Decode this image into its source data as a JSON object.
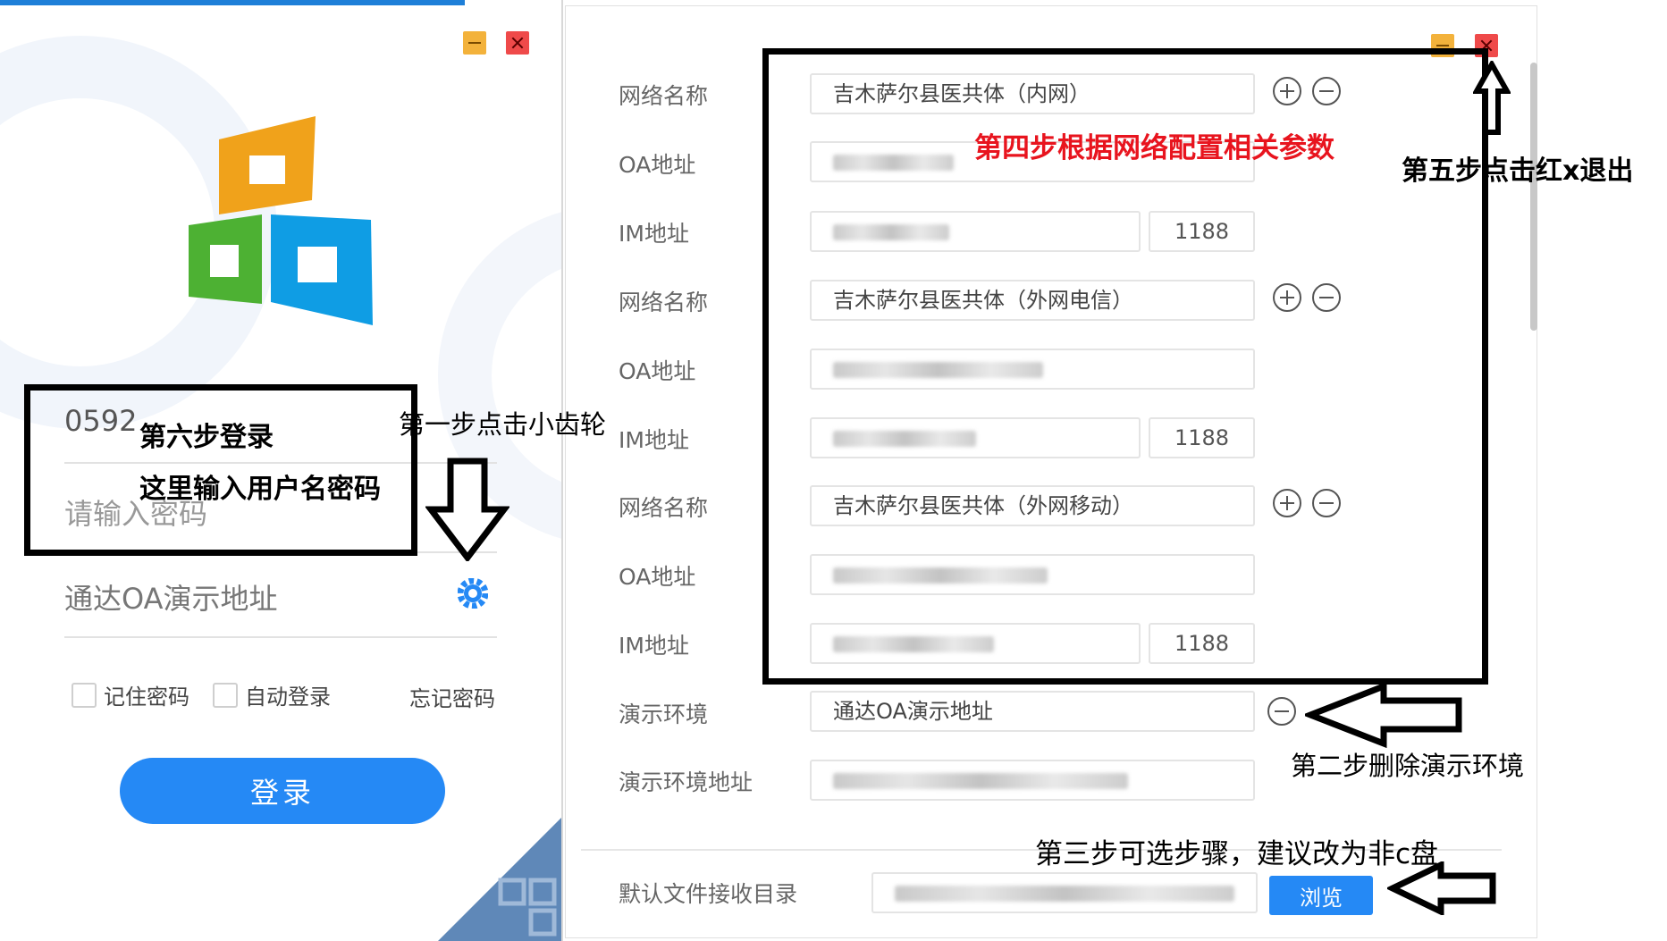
{
  "login": {
    "username_value": "0592",
    "password_placeholder": "请输入密码",
    "server_value": "通达OA演示地址",
    "remember_password": "记住密码",
    "auto_login": "自动登录",
    "forgot_password": "忘记密码",
    "login_button": "登录"
  },
  "settings": {
    "network_label": "网络名称",
    "oa_label": "OA地址",
    "im_label": "IM地址",
    "networks": [
      {
        "name": "吉木萨尔县医共体（内网）",
        "port": "1188"
      },
      {
        "name": "吉木萨尔县医共体（外网电信）",
        "port": "1188"
      },
      {
        "name": "吉木萨尔县医共体（外网移动）",
        "port": "1188"
      }
    ],
    "demo_env_label": "演示环境",
    "demo_env_value": "通达OA演示地址",
    "demo_env_addr_label": "演示环境地址",
    "download_dir_label": "默认文件接收目录",
    "browse_button": "浏览"
  },
  "annotations": {
    "step1": "第一步点击小齿轮",
    "step2": "第二步删除演示环境",
    "step3": "第三步可选步骤，建议改为非c盘",
    "step4": "第四步根据网络配置相关参数",
    "step5": "第五步点击红x退出",
    "step6_line1": "第六步登录",
    "step6_line2": "这里输入用户名密码"
  },
  "colors": {
    "primary_blue": "#2589f5",
    "annotation_red": "#e8141e",
    "close_red": "#ef4a4a",
    "minimize_orange": "#f3b23b"
  }
}
